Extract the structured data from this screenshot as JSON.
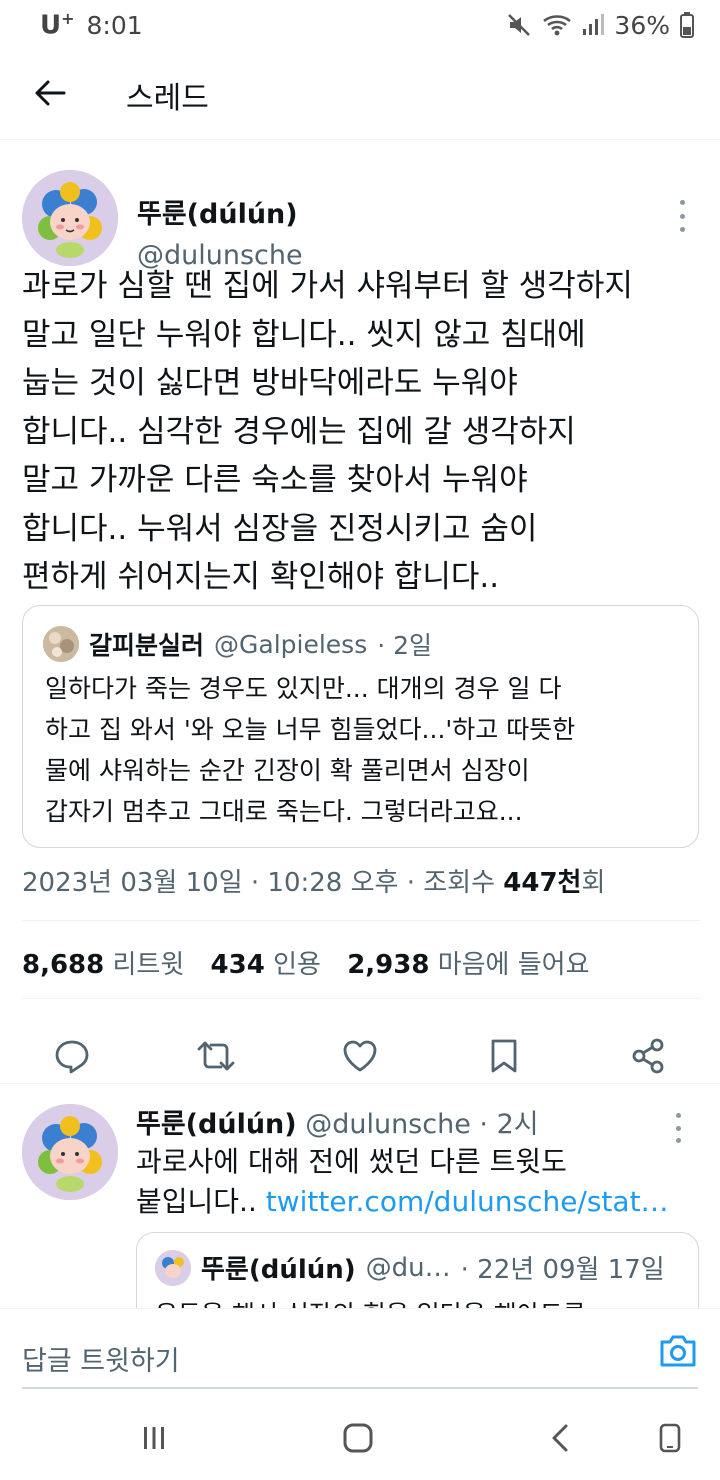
{
  "status_bar": {
    "carrier": "U",
    "carrier_sup": "+",
    "time": "8:01",
    "battery": "36%",
    "icons": [
      "mute-icon",
      "wifi-icon",
      "signal-icon",
      "battery-icon"
    ]
  },
  "header": {
    "back_icon": "back-arrow-icon",
    "title": "스레드"
  },
  "main_tweet": {
    "author_name": "뚜룬(dúlún)",
    "author_handle": "@dulunsche",
    "text": "과로가 심할 땐 집에 가서 샤워부터 할 생각하지\n말고 일단 누워야 합니다.. 씻지 않고 침대에\n눕는 것이 싫다면 방바닥에라도 누워야\n합니다.. 심각한 경우에는 집에 갈 생각하지\n말고 가까운 다른 숙소를 찾아서 누워야\n합니다.. 누워서 심장을 진정시키고 숨이\n편하게 쉬어지는지 확인해야 합니다..",
    "quote": {
      "author_name": "갈피분실러",
      "author_handle": "@Galpieless",
      "time": "· 2일",
      "text": "일하다가 죽는 경우도 있지만... 대개의 경우 일 다\n하고 집 와서 '와 오늘 너무 힘들었다...'하고 따뜻한\n물에 샤워하는 순간 긴장이 확 풀리면서 심장이\n갑자기 멈추고 그대로 죽는다. 그렇더라고요..."
    },
    "meta": {
      "date_time": "2023년 03월 10일 · 10:28 오후 · 조회수 ",
      "views_count": "447천",
      "views_unit": "회"
    },
    "stats": {
      "retweets_count": "8,688",
      "retweets_label": "리트윗",
      "quotes_count": "434",
      "quotes_label": "인용",
      "likes_count": "2,938",
      "likes_label": "마음에 들어요"
    },
    "actions": [
      "reply-icon",
      "retweet-icon",
      "like-icon",
      "bookmark-icon",
      "share-icon"
    ]
  },
  "reply_tweet": {
    "author_name": "뚜룬(dúlún)",
    "author_handle": "@dulunsche",
    "time": "· 2시",
    "text_line1": "과로사에 대해 전에 썼던 다른 트윗도",
    "text_line2": "붙입니다.. ",
    "link": "twitter.com/dulunsche/stat…",
    "quote": {
      "author_name": "뚜룬(dúlún)",
      "author_handle": "@du…",
      "time": "· 22년 09월 17일",
      "text": "운동을 해서 심장의 힘을 일단을 해야도록"
    }
  },
  "composer": {
    "placeholder": "답글 트윗하기",
    "camera_icon": "camera-icon"
  },
  "nav_bar": {
    "icons": [
      "recents-icon",
      "home-icon",
      "back-icon",
      "rotate-icon"
    ]
  },
  "colors": {
    "accent": "#1d9bf0",
    "secondary_text": "#536471",
    "primary_text": "#0f1419",
    "border": "#cfd9de"
  }
}
